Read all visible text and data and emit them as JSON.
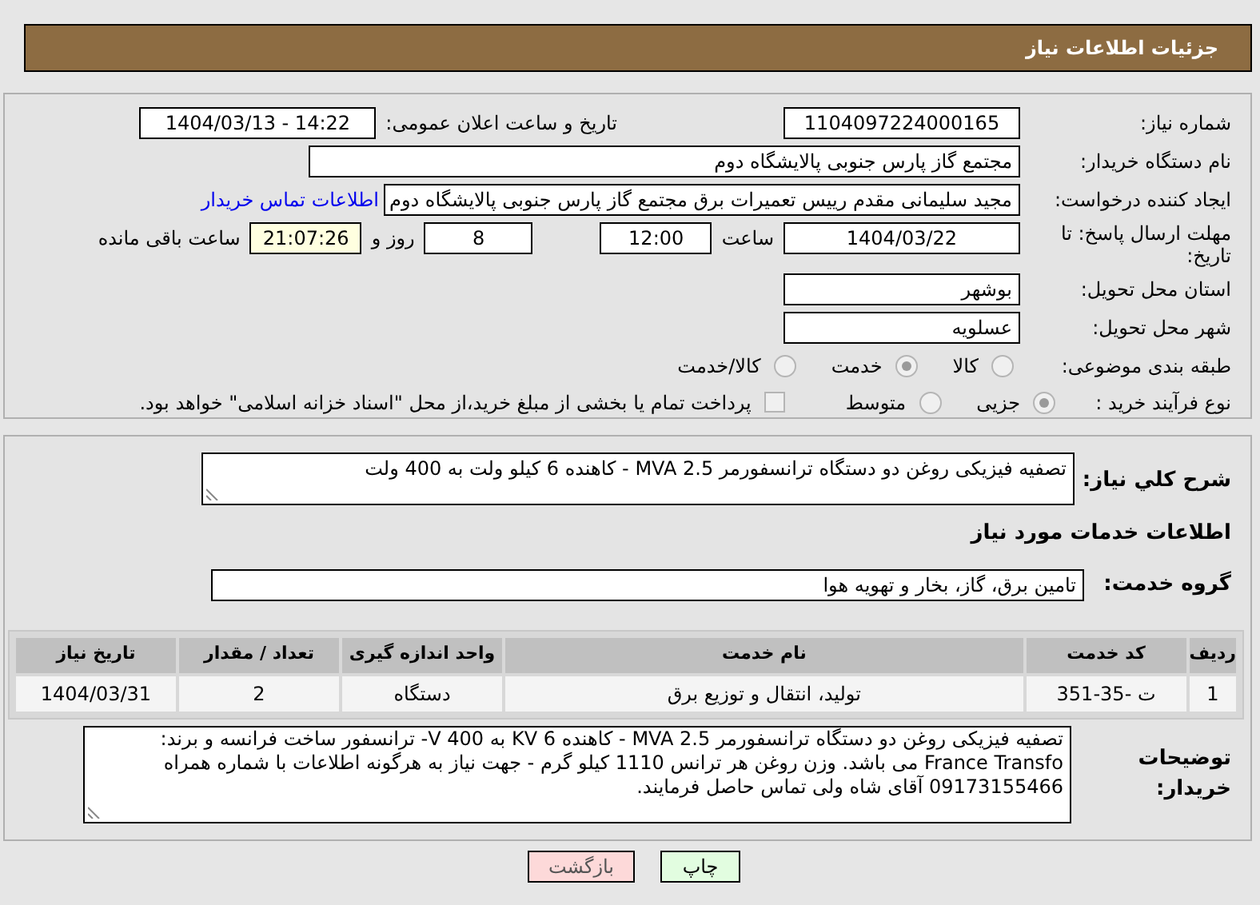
{
  "header": {
    "title": "جزئیات اطلاعات نیاز"
  },
  "need_number": {
    "label": "شماره نیاز:",
    "value": "1104097224000165"
  },
  "announce": {
    "label": "تاریخ و ساعت اعلان عمومی:",
    "value": "1404/03/13 - 14:22"
  },
  "buyer_org": {
    "label": "نام دستگاه خریدار:",
    "value": "مجتمع گاز پارس جنوبی  پالایشگاه دوم"
  },
  "requester": {
    "label": "ایجاد کننده درخواست:",
    "value": "مجید سلیمانی مقدم رییس تعمیرات برق مجتمع گاز پارس جنوبی  پالایشگاه دوم",
    "link": "اطلاعات تماس خریدار"
  },
  "deadline": {
    "label": "مهلت ارسال پاسخ: تا تاریخ:",
    "date": "1404/03/22",
    "time_label": "ساعت",
    "time": "12:00",
    "days": "8",
    "days_label": "روز و",
    "remaining": "21:07:26",
    "remaining_label": "ساعت باقی مانده"
  },
  "province": {
    "label": "استان محل تحویل:",
    "value": "بوشهر"
  },
  "city": {
    "label": "شهر محل تحویل:",
    "value": "عسلویه"
  },
  "category": {
    "label": "طبقه بندی موضوعی:",
    "options": [
      {
        "label": "کالا",
        "selected": false
      },
      {
        "label": "خدمت",
        "selected": true
      },
      {
        "label": "کالا/خدمت",
        "selected": false
      }
    ]
  },
  "process": {
    "label": "نوع فرآیند خرید :",
    "options": [
      {
        "label": "جزیی",
        "selected": true
      },
      {
        "label": "متوسط",
        "selected": false
      }
    ],
    "treasury": {
      "label": "پرداخت تمام یا بخشی از مبلغ خرید،از محل \"اسناد خزانه اسلامی\" خواهد بود.",
      "checked": false
    }
  },
  "summary": {
    "label": "شرح کلي نیاز:",
    "value": "تصفیه فیزیکی روغن دو دستگاه ترانسفورمر MVA 2.5 - کاهنده 6 کیلو ولت به 400 ولت"
  },
  "services_title": "اطلاعات خدمات مورد نیاز",
  "service_group": {
    "label": "گروه خدمت:",
    "value": "تامین برق، گاز، بخار و تهویه هوا"
  },
  "table": {
    "columns": [
      "ردیف",
      "کد خدمت",
      "نام خدمت",
      "واحد اندازه گیری",
      "تعداد / مقدار",
      "تاریخ نیاز"
    ],
    "rows": [
      [
        "1",
        "ت -35-351",
        "تولید، انتقال و توزیع برق",
        "دستگاه",
        "2",
        "1404/03/31"
      ]
    ]
  },
  "buyer_notes": {
    "label": "توضیحات خریدار:",
    "value": "تصفیه فیزیکی روغن دو دستگاه ترانسفورمر MVA 2.5 - کاهنده 6 KV به 400 V- ترانسفور ساخت فرانسه و برند: France Transfo می باشد. وزن روغن هر ترانس 1110 کیلو گرم - جهت نیاز به هرگونه اطلاعات با شماره همراه 09173155466 آقای شاه ولی تماس حاصل فرمایند."
  },
  "buttons": [
    {
      "label": "چاپ",
      "kind": "print"
    },
    {
      "label": "بازگشت",
      "kind": "back"
    }
  ]
}
